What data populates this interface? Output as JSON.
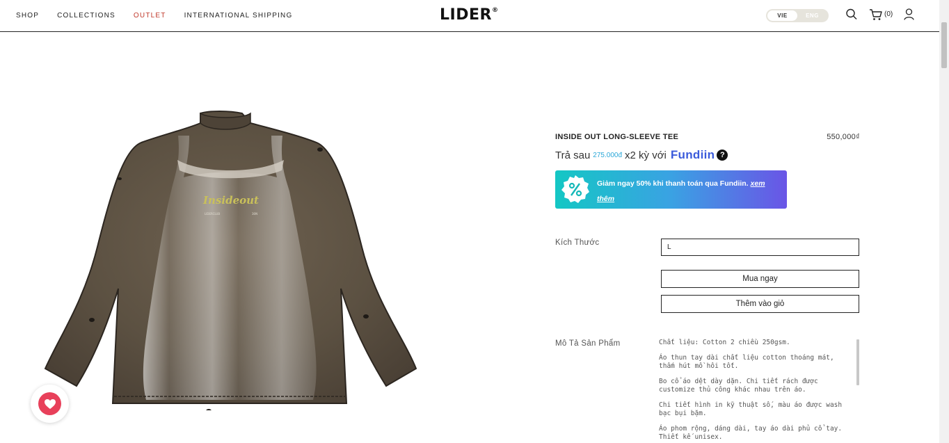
{
  "nav": {
    "items": [
      "SHOP",
      "COLLECTIONS",
      "OUTLET",
      "INTERNATIONAL SHIPPING"
    ]
  },
  "brand": {
    "logo": "LIDER",
    "mark": "®"
  },
  "lang": {
    "vie": "VIE",
    "eng": "ENG"
  },
  "cart": {
    "count": "(0)"
  },
  "product": {
    "name": "INSIDE OUT LONG-SLEEVE TEE",
    "price": "550,000₫",
    "image_print_text": "Insideout",
    "image_small_left": "LIDERCLUB",
    "image_small_right": "30N"
  },
  "paylater": {
    "prefix": "Trả sau",
    "amount": "275.000đ",
    "suffix": "x2 kỳ với",
    "provider": "Fundiin",
    "help": "?"
  },
  "promo": {
    "text": "Giảm ngay 50% khi thanh toán qua Fundiin.",
    "link": "xem thêm"
  },
  "size": {
    "label": "Kích Thước",
    "value": "L"
  },
  "buttons": {
    "buy_now": "Mua ngay",
    "add_to_cart": "Thêm vào giỏ"
  },
  "description": {
    "label": "Mô Tả Sản Phẩm",
    "paragraphs": [
      "Chất liệu: Cotton 2 chiều 250gsm.",
      "Áo thun tay dài chất liệu cotton thoáng mát, thấm hút mồ hôi tốt.",
      "Bo cổ áo dệt dày dặn. Chi tiết rách được customize thủ công khác nhau trên áo.",
      "Chi tiết hình in kỹ thuật số, màu áo được wash bạc bụi bặm.",
      "Áo phom rộng, dáng dài, tay áo dài phủ cổ tay. Thiết kế unisex."
    ]
  },
  "colors": {
    "accent_outlet": "#c0392b",
    "wishlist": "#e8405a",
    "paylater_amount": "#2aa7d8"
  },
  "icons": {
    "search": "search-icon",
    "cart": "cart-icon",
    "user": "user-icon",
    "heart": "heart-icon",
    "percent": "percent-badge-icon"
  }
}
